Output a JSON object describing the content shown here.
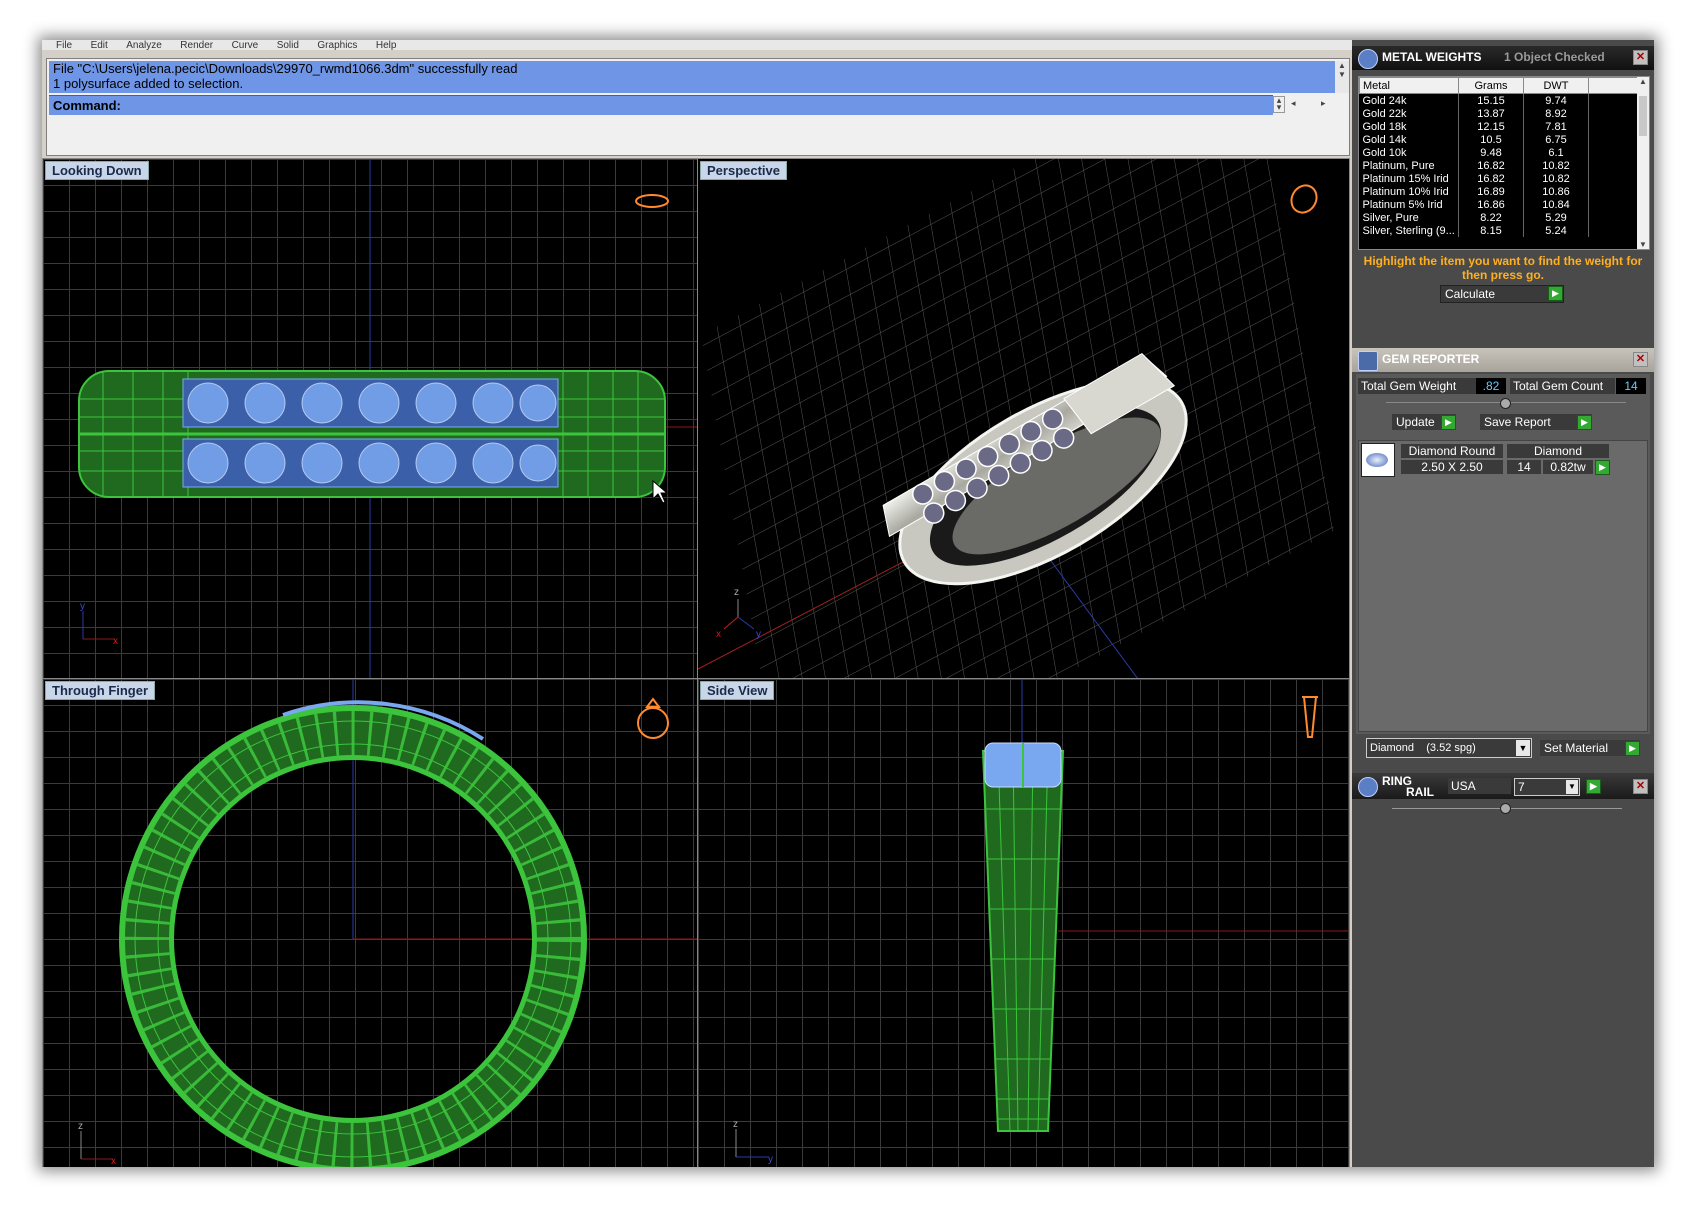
{
  "menu": [
    "File",
    "Edit",
    "Analyze",
    "Render",
    "Curve",
    "Solid",
    "Graphics",
    "Help"
  ],
  "history": {
    "line1": "File \"C:\\Users\\jelena.pecic\\Downloads\\29970_rwmd1066.3dm\" successfully read",
    "line2": "1 polysurface added to selection."
  },
  "command": {
    "label": "Command:"
  },
  "viewports": {
    "top_left": {
      "label": "Looking Down",
      "axis1": "y",
      "axis2": "x"
    },
    "top_right": {
      "label": "Perspective",
      "axis1": "z",
      "axis2": "y",
      "axis3": "x"
    },
    "bottom_left": {
      "label": "Through Finger",
      "axis1": "z",
      "axis2": "x"
    },
    "bottom_right": {
      "label": "Side View",
      "axis1": "z",
      "axis2": "y"
    }
  },
  "metal_weights": {
    "title": "METAL WEIGHTS",
    "status": "1 Object Checked",
    "columns": [
      "Metal",
      "Grams",
      "DWT"
    ],
    "rows": [
      [
        "Gold 24k",
        "15.15",
        "9.74"
      ],
      [
        "Gold 22k",
        "13.87",
        "8.92"
      ],
      [
        "Gold 18k",
        "12.15",
        "7.81"
      ],
      [
        "Gold 14k",
        "10.5",
        "6.75"
      ],
      [
        "Gold 10k",
        "9.48",
        "6.1"
      ],
      [
        "Platinum, Pure",
        "16.82",
        "10.82"
      ],
      [
        "Platinum 15% Irid",
        "16.82",
        "10.82"
      ],
      [
        "Platinum 10% Irid",
        "16.89",
        "10.86"
      ],
      [
        "Platinum 5% Irid",
        "16.86",
        "10.84"
      ],
      [
        "Silver, Pure",
        "8.22",
        "5.29"
      ],
      [
        "Silver, Sterling (9...",
        "8.15",
        "5.24"
      ]
    ],
    "instruction": "Highlight the item you want to find the weight for then press go.",
    "calculate_label": "Calculate"
  },
  "gem_reporter": {
    "title": "GEM REPORTER",
    "total_weight_label": "Total Gem Weight",
    "total_weight_value": ".82",
    "total_count_label": "Total Gem Count",
    "total_count_value": "14",
    "update_label": "Update",
    "save_report_label": "Save Report",
    "gem": {
      "shape": "Diamond Round",
      "material": "Diamond",
      "size": "2.50 X 2.50",
      "count": "14",
      "weight": "0.82tw"
    },
    "material_select": "Diamond    (3.52 spg)",
    "set_material_label": "Set Material"
  },
  "ring_rail": {
    "title_line1": "RING",
    "title_line2": "RAIL",
    "country": "USA",
    "size": "7"
  },
  "colors": {
    "history_bg": "#6f95e6",
    "wire_green": "#3cc43c",
    "gem_blue": "#7aa8f0",
    "panel_dark": "#4a4a4a",
    "instruction_orange": "#ffb020"
  }
}
